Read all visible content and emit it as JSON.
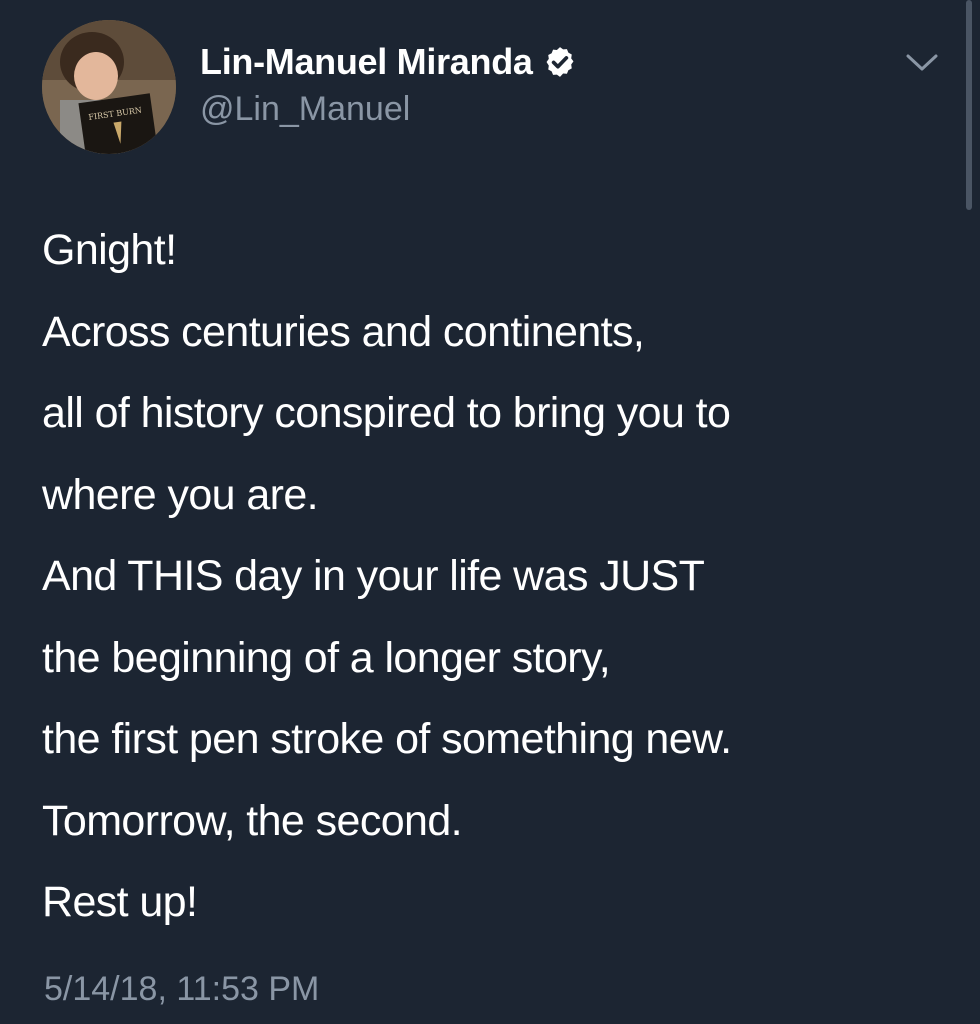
{
  "author": {
    "display_name": "Lin-Manuel Miranda",
    "handle": "@Lin_Manuel",
    "verified": true,
    "avatar_book_title": "FIRST BURN"
  },
  "tweet": {
    "lines": [
      "Gnight!",
      "Across centuries and continents,",
      "all of history conspired to bring you to",
      "where you are.",
      "And THIS day in your life was JUST",
      "the beginning of a longer story,",
      "the first pen stroke of something new.",
      "Tomorrow, the second.",
      "Rest up!"
    ],
    "timestamp": "5/14/18, 11:53 PM"
  },
  "icons": {
    "menu": "chevron-down-icon",
    "verified": "verified-badge-icon"
  },
  "colors": {
    "background": "#1c2532",
    "text": "#ffffff",
    "secondary_text": "#8a96a5"
  }
}
